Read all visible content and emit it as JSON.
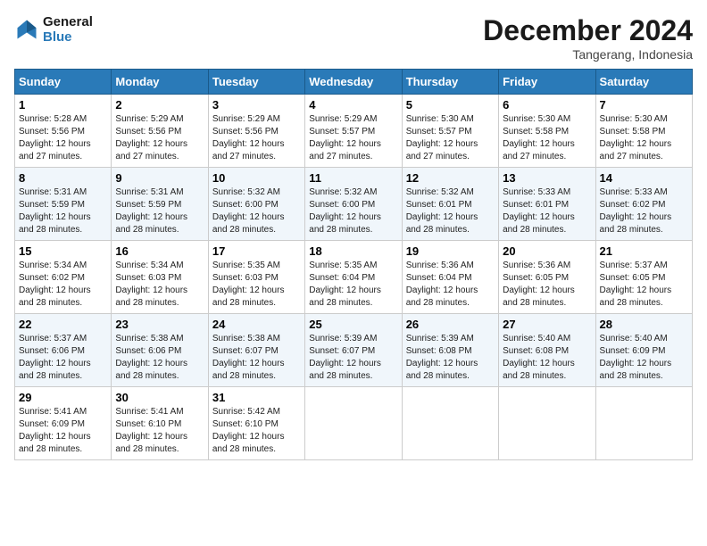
{
  "logo": {
    "line1": "General",
    "line2": "Blue"
  },
  "title": "December 2024",
  "subtitle": "Tangerang, Indonesia",
  "days_header": [
    "Sunday",
    "Monday",
    "Tuesday",
    "Wednesday",
    "Thursday",
    "Friday",
    "Saturday"
  ],
  "weeks": [
    [
      {
        "day": "1",
        "sunrise": "5:28 AM",
        "sunset": "5:56 PM",
        "daylight": "12 hours and 27 minutes."
      },
      {
        "day": "2",
        "sunrise": "5:29 AM",
        "sunset": "5:56 PM",
        "daylight": "12 hours and 27 minutes."
      },
      {
        "day": "3",
        "sunrise": "5:29 AM",
        "sunset": "5:56 PM",
        "daylight": "12 hours and 27 minutes."
      },
      {
        "day": "4",
        "sunrise": "5:29 AM",
        "sunset": "5:57 PM",
        "daylight": "12 hours and 27 minutes."
      },
      {
        "day": "5",
        "sunrise": "5:30 AM",
        "sunset": "5:57 PM",
        "daylight": "12 hours and 27 minutes."
      },
      {
        "day": "6",
        "sunrise": "5:30 AM",
        "sunset": "5:58 PM",
        "daylight": "12 hours and 27 minutes."
      },
      {
        "day": "7",
        "sunrise": "5:30 AM",
        "sunset": "5:58 PM",
        "daylight": "12 hours and 27 minutes."
      }
    ],
    [
      {
        "day": "8",
        "sunrise": "5:31 AM",
        "sunset": "5:59 PM",
        "daylight": "12 hours and 28 minutes."
      },
      {
        "day": "9",
        "sunrise": "5:31 AM",
        "sunset": "5:59 PM",
        "daylight": "12 hours and 28 minutes."
      },
      {
        "day": "10",
        "sunrise": "5:32 AM",
        "sunset": "6:00 PM",
        "daylight": "12 hours and 28 minutes."
      },
      {
        "day": "11",
        "sunrise": "5:32 AM",
        "sunset": "6:00 PM",
        "daylight": "12 hours and 28 minutes."
      },
      {
        "day": "12",
        "sunrise": "5:32 AM",
        "sunset": "6:01 PM",
        "daylight": "12 hours and 28 minutes."
      },
      {
        "day": "13",
        "sunrise": "5:33 AM",
        "sunset": "6:01 PM",
        "daylight": "12 hours and 28 minutes."
      },
      {
        "day": "14",
        "sunrise": "5:33 AM",
        "sunset": "6:02 PM",
        "daylight": "12 hours and 28 minutes."
      }
    ],
    [
      {
        "day": "15",
        "sunrise": "5:34 AM",
        "sunset": "6:02 PM",
        "daylight": "12 hours and 28 minutes."
      },
      {
        "day": "16",
        "sunrise": "5:34 AM",
        "sunset": "6:03 PM",
        "daylight": "12 hours and 28 minutes."
      },
      {
        "day": "17",
        "sunrise": "5:35 AM",
        "sunset": "6:03 PM",
        "daylight": "12 hours and 28 minutes."
      },
      {
        "day": "18",
        "sunrise": "5:35 AM",
        "sunset": "6:04 PM",
        "daylight": "12 hours and 28 minutes."
      },
      {
        "day": "19",
        "sunrise": "5:36 AM",
        "sunset": "6:04 PM",
        "daylight": "12 hours and 28 minutes."
      },
      {
        "day": "20",
        "sunrise": "5:36 AM",
        "sunset": "6:05 PM",
        "daylight": "12 hours and 28 minutes."
      },
      {
        "day": "21",
        "sunrise": "5:37 AM",
        "sunset": "6:05 PM",
        "daylight": "12 hours and 28 minutes."
      }
    ],
    [
      {
        "day": "22",
        "sunrise": "5:37 AM",
        "sunset": "6:06 PM",
        "daylight": "12 hours and 28 minutes."
      },
      {
        "day": "23",
        "sunrise": "5:38 AM",
        "sunset": "6:06 PM",
        "daylight": "12 hours and 28 minutes."
      },
      {
        "day": "24",
        "sunrise": "5:38 AM",
        "sunset": "6:07 PM",
        "daylight": "12 hours and 28 minutes."
      },
      {
        "day": "25",
        "sunrise": "5:39 AM",
        "sunset": "6:07 PM",
        "daylight": "12 hours and 28 minutes."
      },
      {
        "day": "26",
        "sunrise": "5:39 AM",
        "sunset": "6:08 PM",
        "daylight": "12 hours and 28 minutes."
      },
      {
        "day": "27",
        "sunrise": "5:40 AM",
        "sunset": "6:08 PM",
        "daylight": "12 hours and 28 minutes."
      },
      {
        "day": "28",
        "sunrise": "5:40 AM",
        "sunset": "6:09 PM",
        "daylight": "12 hours and 28 minutes."
      }
    ],
    [
      {
        "day": "29",
        "sunrise": "5:41 AM",
        "sunset": "6:09 PM",
        "daylight": "12 hours and 28 minutes."
      },
      {
        "day": "30",
        "sunrise": "5:41 AM",
        "sunset": "6:10 PM",
        "daylight": "12 hours and 28 minutes."
      },
      {
        "day": "31",
        "sunrise": "5:42 AM",
        "sunset": "6:10 PM",
        "daylight": "12 hours and 28 minutes."
      },
      null,
      null,
      null,
      null
    ]
  ]
}
